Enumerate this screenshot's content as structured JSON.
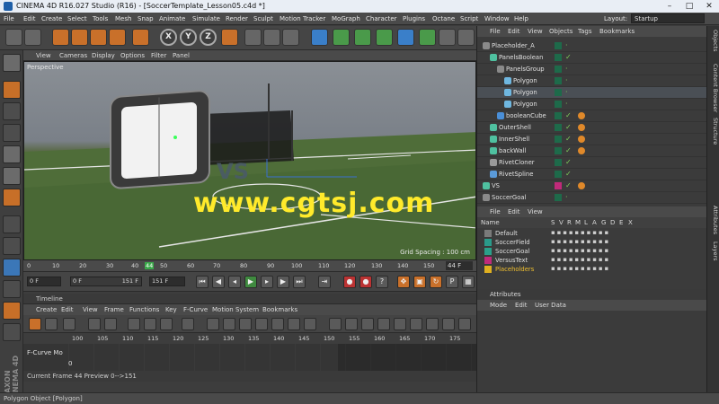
{
  "window": {
    "title": "CINEMA 4D R16.027 Studio (R16) - [SoccerTemplate_Lesson05.c4d *]",
    "controls": [
      "–",
      "□",
      "✕"
    ]
  },
  "menubar": {
    "items": [
      "File",
      "Edit",
      "Create",
      "Select",
      "Tools",
      "Mesh",
      "Snap",
      "Animate",
      "Simulate",
      "Render",
      "Sculpt",
      "Motion Tracker",
      "MoGraph",
      "Character",
      "Plugins",
      "Octane",
      "Script",
      "Window",
      "Help"
    ],
    "layout_label": "Layout:",
    "layout_value": "Startup"
  },
  "toolbar": {
    "axis": [
      "X",
      "Y",
      "Z"
    ]
  },
  "viewport": {
    "menu": [
      "View",
      "Cameras",
      "Display",
      "Options",
      "Filter",
      "Panel"
    ],
    "label": "Perspective",
    "grid_spacing": "Grid Spacing : 100 cm",
    "watermark": "www.cgtsj.com"
  },
  "ruler": {
    "ticks": [
      "0",
      "10",
      "20",
      "30",
      "40",
      "44",
      "50",
      "60",
      "70",
      "80",
      "90",
      "100",
      "110",
      "120",
      "130",
      "140",
      "150"
    ],
    "current": "44 F"
  },
  "transport": {
    "start": "0 F",
    "range_min": "0 F",
    "range_max": "151 F",
    "end": "151 F"
  },
  "timeline": {
    "title": "Timeline",
    "menu": [
      "Create",
      "Edit",
      "View",
      "Frame",
      "Functions",
      "Key",
      "F-Curve",
      "Motion System",
      "Bookmarks"
    ],
    "ticks": [
      "100",
      "105",
      "110",
      "115",
      "120",
      "125",
      "130",
      "135",
      "140",
      "145",
      "150",
      "155",
      "160",
      "165",
      "170",
      "175"
    ],
    "fcurve_label": "F-Curve Mo",
    "zero": "0",
    "status": "Current Frame  44  Preview  0-->151"
  },
  "statusbar": {
    "text": "Polygon Object [Polygon]"
  },
  "objects": {
    "menu": [
      "File",
      "Edit",
      "View",
      "Objects",
      "Tags",
      "Bookmarks"
    ],
    "rows": [
      {
        "name": "Placeholder_A",
        "indent": 0
      },
      {
        "name": "PanelsBoolean",
        "indent": 1
      },
      {
        "name": "PanelsGroup",
        "indent": 2
      },
      {
        "name": "Polygon",
        "indent": 3
      },
      {
        "name": "Polygon",
        "indent": 3
      },
      {
        "name": "Polygon",
        "indent": 3
      },
      {
        "name": "booleanCube",
        "indent": 2
      },
      {
        "name": "OuterShell",
        "indent": 1
      },
      {
        "name": "InnerShell",
        "indent": 1
      },
      {
        "name": "backWall",
        "indent": 1
      },
      {
        "name": "RivetCloner",
        "indent": 1
      },
      {
        "name": "RivetSpline",
        "indent": 1
      },
      {
        "name": "VS",
        "indent": 0
      },
      {
        "name": "SoccerGoal",
        "indent": 0
      }
    ]
  },
  "layers": {
    "menu": [
      "File",
      "Edit",
      "View"
    ],
    "header": [
      "Name",
      "S",
      "V",
      "R",
      "M",
      "L",
      "A",
      "G",
      "D",
      "E",
      "X"
    ],
    "rows": [
      {
        "name": "Default",
        "color": "#7a7a7a"
      },
      {
        "name": "SoccerField",
        "color": "#2a9a8a"
      },
      {
        "name": "SoccerGoal",
        "color": "#2aa08a"
      },
      {
        "name": "VersusText",
        "color": "#c02a7a"
      },
      {
        "name": "Placeholders",
        "color": "#e0b020"
      }
    ]
  },
  "attributes": {
    "title": "Attributes",
    "menu": [
      "Mode",
      "Edit",
      "User Data"
    ]
  },
  "sidetabs": [
    "Objects",
    "Content Browser",
    "Structure",
    "Attributes",
    "Layers"
  ],
  "colors": {
    "accent_orange": "#c9702a",
    "watermark_yellow": "#ffea2b",
    "check_green": "#7fd05a"
  }
}
